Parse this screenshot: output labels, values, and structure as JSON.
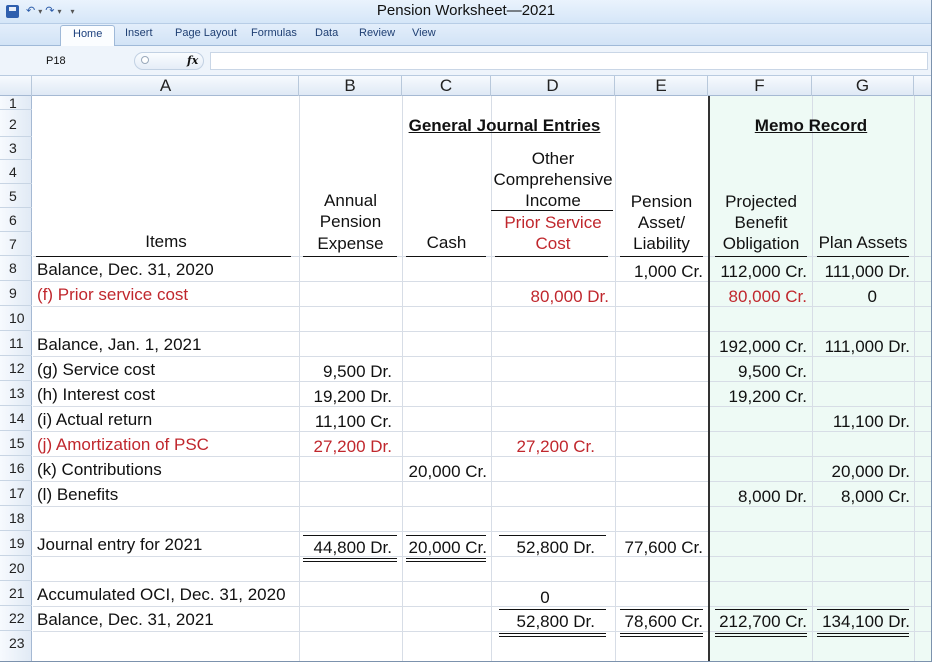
{
  "window": {
    "title": "Pension Worksheet—2021"
  },
  "quick_access": {
    "save_icon": "save-icon",
    "undo_glyph": "↶",
    "redo_glyph": "↷",
    "more_glyph": "▾"
  },
  "ribbon": {
    "tabs": [
      {
        "label": "Home",
        "active": true
      },
      {
        "label": "Insert"
      },
      {
        "label": "Page Layout"
      },
      {
        "label": "Formulas"
      },
      {
        "label": "Data"
      },
      {
        "label": "Review"
      },
      {
        "label": "View"
      }
    ]
  },
  "formula_bar": {
    "name_box": "P18",
    "fx_label": "fx",
    "formula": ""
  },
  "columns": [
    "A",
    "B",
    "C",
    "D",
    "E",
    "F",
    "G"
  ],
  "rows": [
    "1",
    "2",
    "3",
    "4",
    "5",
    "6",
    "7",
    "8",
    "9",
    "10",
    "11",
    "12",
    "13",
    "14",
    "15",
    "16",
    "17",
    "18",
    "19",
    "20",
    "21",
    "22",
    "23"
  ],
  "sheet": {
    "section_headers": {
      "journal": "General Journal Entries",
      "memo": "Memo Record"
    },
    "headers": {
      "items": "Items",
      "expense": [
        "Annual",
        "Pension",
        "Expense"
      ],
      "cash": "Cash",
      "oci": [
        "Other",
        "Comprehensive",
        "Income"
      ],
      "oci_sub": [
        "Prior Service",
        "Cost"
      ],
      "asset": [
        "Pension",
        "Asset/",
        "Liability"
      ],
      "pbo": [
        "Projected",
        "Benefit",
        "Obligation"
      ],
      "plan": "Plan Assets"
    },
    "cells": {
      "a8": "Balance, Dec. 31, 2020",
      "e8": "1,000 Cr.",
      "f8": "112,000 Cr.",
      "g8": "111,000 Dr.",
      "a9": "(f) Prior service cost",
      "d9": "80,000 Dr.",
      "f9": "80,000 Cr.",
      "g9": "0",
      "a11": "Balance, Jan. 1, 2021",
      "f11": "192,000 Cr.",
      "g11": "111,000 Dr.",
      "a12": "(g) Service cost",
      "b12": "9,500 Dr.",
      "f12": "9,500 Cr.",
      "a13": "(h) Interest cost",
      "b13": "19,200 Dr.",
      "f13": "19,200 Cr.",
      "a14": "(i) Actual return",
      "b14": "11,100 Cr.",
      "g14": "11,100 Dr.",
      "a15": "(j) Amortization of PSC",
      "b15": "27,200 Dr.",
      "d15": "27,200 Cr.",
      "a16": "(k) Contributions",
      "c16": "20,000 Cr.",
      "g16": "20,000 Dr.",
      "a17": "(l) Benefits",
      "f17": "8,000 Dr.",
      "g17": "8,000 Cr.",
      "a19": "Journal entry for 2021",
      "b19": "44,800 Dr.",
      "c19": "20,000 Cr.",
      "d19": "52,800 Dr.",
      "e19": "77,600 Cr.",
      "a21": "Accumulated OCI, Dec. 31, 2020",
      "d21": "0",
      "a22": "Balance, Dec. 31, 2021",
      "d22": "52,800 Dr.",
      "e22": "78,600 Cr.",
      "f22": "212,700 Cr.",
      "g22": "134,100 Dr."
    }
  },
  "colors": {
    "red_text": "#c0272d",
    "memo_background": "#eefaf5",
    "ribbon_blue": "#d2e3f6"
  }
}
